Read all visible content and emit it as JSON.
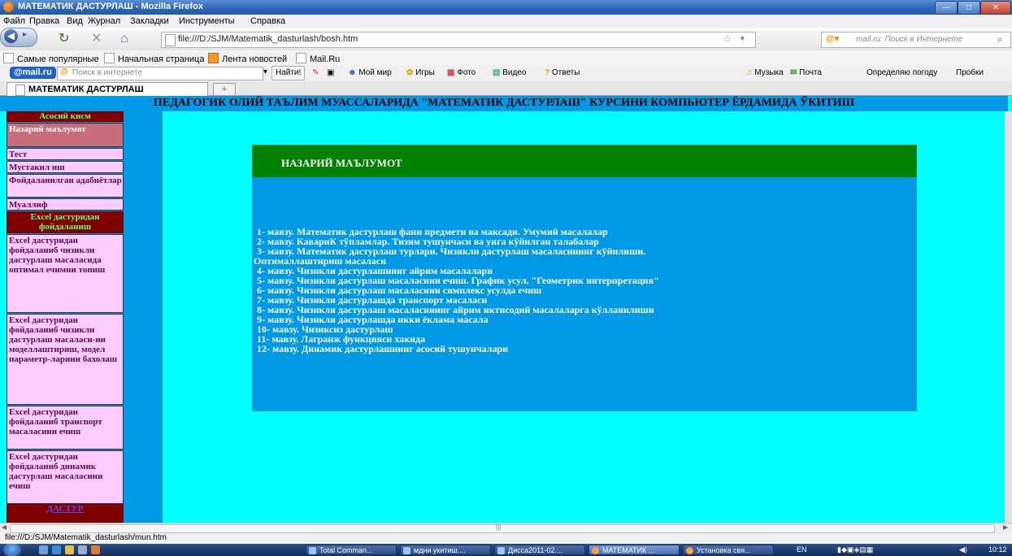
{
  "window": {
    "title": "МАТЕМАТИК ДАСТУРЛАШ - Mozilla Firefox",
    "controls": [
      "—",
      "□",
      "✕"
    ]
  },
  "menu": [
    "Файл",
    "Правка",
    "Вид",
    "Журнал",
    "Закладки",
    "Инструменты",
    "Справка"
  ],
  "nav": {
    "url": "file:///D:/SJM/Matematik_dasturlash/bosh.htm",
    "search_placeholder": "mail.ru: Поиск в Интернете"
  },
  "bookmarks": [
    "Самые популярные",
    "Начальная страница",
    "Лента новостей",
    "Mail.Ru"
  ],
  "mailbar": {
    "logo": "@mail.ru",
    "search_placeholder": "Поиск в интернете",
    "find": "Найти!",
    "links": [
      "Мой мир",
      "Игры",
      "Фото",
      "Видео",
      "Ответы"
    ],
    "right_links": [
      "Музыка",
      "Почта",
      "Определяю погоду",
      "Пробки"
    ]
  },
  "tab": {
    "label": "МАТЕМАТИК ДАСТУРЛАШ",
    "new_tab": "+"
  },
  "page": {
    "header": "ПЕДАГОГИК ОЛИЙ ТАЪЛИМ МУАССАЛАРИДА \"МАТЕМАТИК ДАСТУРЛАШ\" КУРСИНИ КОМПЬЮТЕР ЁРДАМИДА ЎКИТИШ",
    "sidebar": [
      {
        "type": "head",
        "label": "Асосий кисм"
      },
      {
        "type": "item",
        "label": "Назарий маълумот",
        "active": true
      },
      {
        "type": "item",
        "label": "Тест"
      },
      {
        "type": "item",
        "label": "Мустакил иш"
      },
      {
        "type": "item",
        "label": "Фойдаланилган адабиётлар"
      },
      {
        "type": "item",
        "label": "Муаллиф"
      },
      {
        "type": "head",
        "label": "Excel дастуридан фойдаланиш"
      },
      {
        "type": "item",
        "label": "Excel дастуридан фойдаланиб чизикли дастурлаш масаласида оптимал ечимни топиш"
      },
      {
        "type": "item",
        "label": "Excel дастуридан фойдаланиб чизикли дастурлаш масаласи-ни моделлаштириш, модел параметр-ларини бахолаш"
      },
      {
        "type": "item",
        "label": "Excel дастуридан фойдаланиб транспорт масаласини ечиш"
      },
      {
        "type": "item",
        "label": "Excel дастуридан фойдаланиб динамик дастурлаш масаласини ечиш"
      }
    ],
    "sidebar_bottom": "ДАСТУР",
    "section_title": "НАЗАРИЙ МАЪЛУМОТ",
    "topics": [
      "1- мавзу.  Математик дастурлаш фани предмети ва максади. Умумий масалалар",
      "2- мавзу.  КавариК тўпламлар. Тизим тушунчаси ва унга кўйилган талабалар",
      "3- мавзу.  Математик дастурлаш турлари. Чизикли дастурлаш масаласининг кўйилиши.",
      "Оптималлаштириш масаласи",
      "4- мавзу.  Чизикли дастурлашнинг айрим масалалари",
      "5- мавзу.  Чизикли дастурлаш масаласини ечиш. График усул. \"Геометрик интерпретация\"",
      "6- мавзу.  Чизикли дастурлаш масаласини симплекс усулда ечиш",
      "7- мавзу.  Чизикли дастурлашда транспорт масаласи",
      "8- мавзу.  Чизикли дастурлаш масаласининг айрим иктисодий масалаларга кўлланилиши",
      "9- мавзу.  Чизикли дастурлашда икки ёклама масала",
      "10- мавзу.  Чизиксиз дастурлаш",
      "11- мавзу.  Лагранж функцияси хакида",
      "12- мавзу.  Динамик дастурлашнинг асосий тушунчалари"
    ]
  },
  "status": "file:///D:/SJM/Matematik_dasturlash/mun.htm",
  "taskbar": {
    "buttons": [
      "Total Comman...",
      "мдни укитиш....",
      "Дисса2011-02....",
      "МАТЕМАТИК ...",
      "Установка свя..."
    ],
    "lang": "EN",
    "clock": "10:12"
  }
}
